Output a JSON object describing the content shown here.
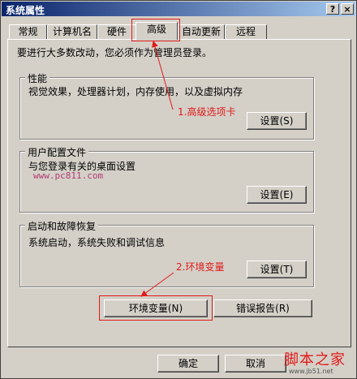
{
  "window": {
    "title": "系统属性",
    "help_glyph": "?",
    "close_glyph": "×"
  },
  "tabs": [
    "常规",
    "计算机名",
    "硬件",
    "高级",
    "自动更新",
    "远程"
  ],
  "active_tab": "高级",
  "notice": "要进行大多数改动，您必须作为管理员登录。",
  "groups": {
    "performance": {
      "label": "性能",
      "text": "视觉效果，处理器计划，内存使用，以及虚拟内存",
      "button": "设置(S)"
    },
    "profile": {
      "label": "用户配置文件",
      "text": "与您登录有关的桌面设置",
      "button": "设置(E)"
    },
    "startup": {
      "label": "启动和故障恢复",
      "text": "系统启动，系统失败和调试信息",
      "button": "设置(T)"
    }
  },
  "buttons": {
    "env": "环境变量(N)",
    "error": "错误报告(R)",
    "ok": "确定",
    "cancel": "取消"
  },
  "annotations": {
    "step1": "1.高级选项卡",
    "step2": "2.环境变量"
  },
  "watermark": {
    "url": "www.pc811.com",
    "logo": "脚本之家",
    "logo_url": "www.jb51.net"
  },
  "colors": {
    "annotation": "#e11a1a",
    "titlebar": "#0a246a",
    "dialog": "#d4d0c8",
    "watermark": "#b23a73"
  }
}
